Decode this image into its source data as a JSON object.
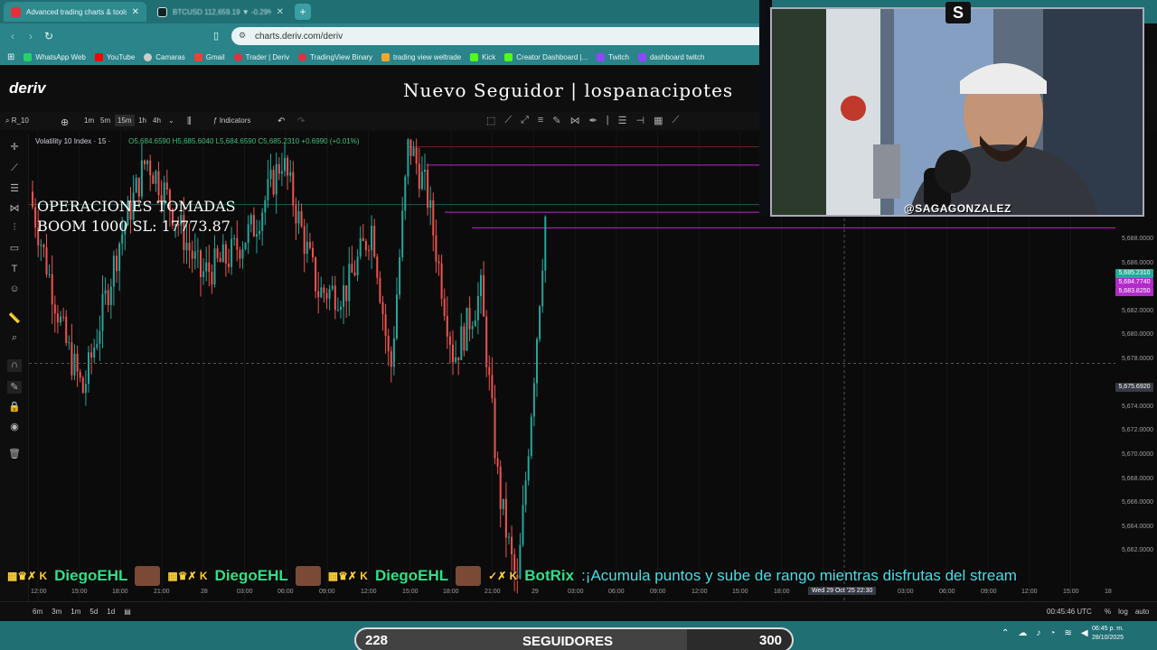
{
  "browser": {
    "tabs": [
      {
        "title": "Advanced trading charts & tools",
        "active": true
      },
      {
        "title": "BTCUSD 112,659.19 ▼ -0.29% Saga",
        "active": false
      }
    ],
    "new_tab": "+",
    "url": "charts.deriv.com/deriv",
    "bookmarks": [
      "WhatsApp Web",
      "YouTube",
      "Camaras",
      "Gmail",
      "Trader | Deriv",
      "TradingView Binary",
      "trading view weltrade",
      "Kick",
      "Creator Dashboard |...",
      "Twitch",
      "dashboard twitch"
    ]
  },
  "header": {
    "logo": "deriv",
    "banner": "Nuevo Seguidor | lospanacipotes"
  },
  "toolbar": {
    "symbol": "R_10",
    "timeframes": [
      "1m",
      "5m",
      "15m",
      "1h",
      "4h"
    ],
    "selected_timeframe": "15m",
    "indicators": "Indicators"
  },
  "legend": {
    "title": "Volatility 10 Index · 15 ·",
    "ohlc": "O5,684.6590 H5,685.6040 L5,684.6590 C5,685.2310 +0.6990 (+0.01%)"
  },
  "overlay": {
    "line1": "OPERACIONES TOMADAS",
    "line2": "BOOM 1000 SL: 17773.87"
  },
  "price_axis": {
    "labels": [
      "5,688.0000",
      "5,686.0000",
      "5,682.0000",
      "5,680.0000",
      "5,678.0000",
      "5,674.0000",
      "5,672.0000",
      "5,670.0000",
      "5,668.0000",
      "5,666.0000",
      "5,664.0000",
      "5,662.0000"
    ],
    "tags": [
      {
        "text": "5,685.2310",
        "color": "#22ab94"
      },
      {
        "text": "5,684.7740",
        "color": "#b22bc9"
      },
      {
        "text": "5,683.8250",
        "color": "#b22bc9"
      }
    ],
    "crosshair_price": "5,675.6920"
  },
  "time_axis": {
    "labels": [
      "12:00",
      "15:00",
      "18:00",
      "21:00",
      "28",
      "03:00",
      "06:00",
      "09:00",
      "12:00",
      "15:00",
      "18:00",
      "21:00",
      "29",
      "03:00",
      "06:00",
      "09:00",
      "12:00",
      "15:00",
      "18:00",
      "03:00",
      "06:00",
      "09:00",
      "12:00",
      "15:00",
      "18"
    ],
    "crosshair_time": "Wed 29 Oct '25   22:30"
  },
  "bottom": {
    "ranges": [
      "6m",
      "3m",
      "1m",
      "5d",
      "1d"
    ],
    "clock": "00:45:46 UTC",
    "options": [
      "%",
      "log",
      "auto"
    ]
  },
  "ticker": {
    "user1": "DiegoEHL",
    "user2": "DiegoEHL",
    "user3": "DiegoEHL",
    "bot": "BotRix",
    "message": ":¡Acumula puntos y sube de rango mientras disfrutas del stream"
  },
  "stream": {
    "handle": "@SAGAGONZALEZ",
    "logo": "S",
    "followers_current": "228",
    "followers_label": "SEGUIDORES",
    "followers_goal": "300",
    "followers_progress": 0.76
  },
  "taskbar": {
    "time": "06:45 p. m.",
    "date": "28/10/2025"
  },
  "colors": {
    "up": "#26a69a",
    "down": "#ef5350",
    "magenta": "#c026d3",
    "teal": "#1f6f73"
  }
}
